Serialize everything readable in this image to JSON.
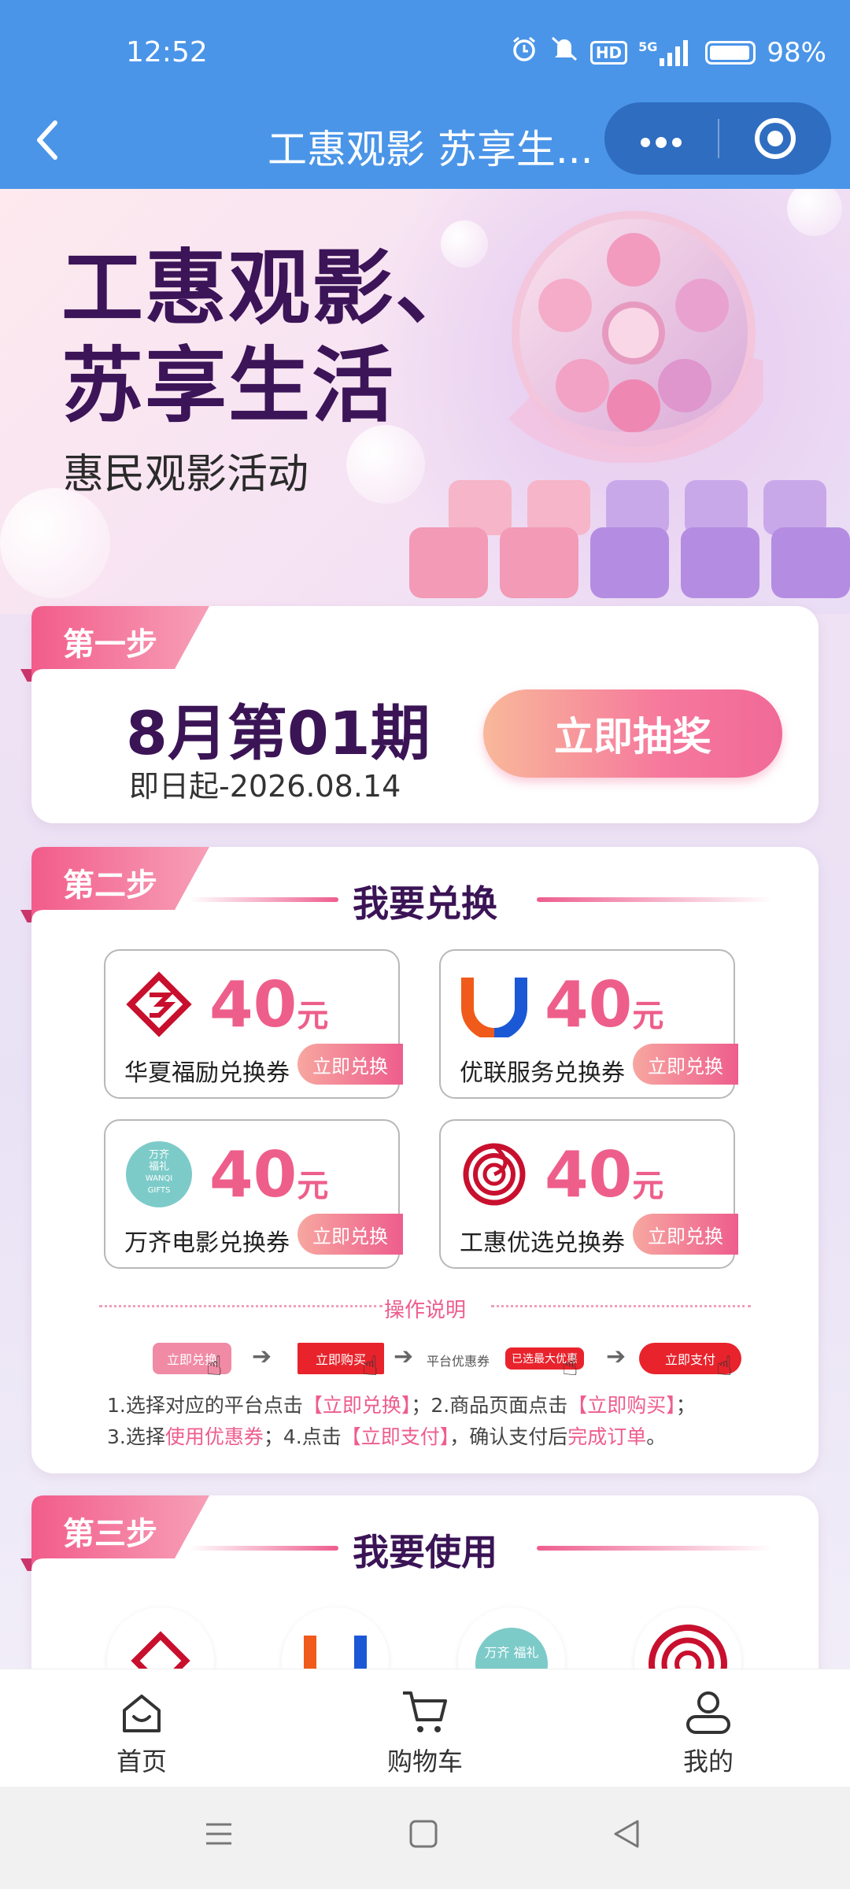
{
  "status_bar": {
    "time": "12:52",
    "network": "5G",
    "hd": "HD",
    "battery": "98%"
  },
  "nav": {
    "title": "工惠观影 苏享生...",
    "more_icon": "more-dots-icon",
    "capsule_icon": "target-icon"
  },
  "hero": {
    "title_line1": "工惠观影、",
    "title_line2": "苏享生活",
    "subtitle": "惠民观影活动"
  },
  "step1": {
    "tag": "第一步",
    "period": "8月第01期",
    "date": "即日起-2026.08.14",
    "button": "立即抽奖"
  },
  "step2": {
    "tag": "第二步",
    "title": "我要兑换",
    "coupons": [
      {
        "amount": "40",
        "unit": "元",
        "name": "华夏福励兑换券",
        "button": "立即兑换",
        "logo": "huaxia-logo"
      },
      {
        "amount": "40",
        "unit": "元",
        "name": "优联服务兑换券",
        "button": "立即兑换",
        "logo": "youlian-logo"
      },
      {
        "amount": "40",
        "unit": "元",
        "name": "万齐电影兑换券",
        "button": "立即兑换",
        "logo": "wanqi-logo",
        "logo_text": [
          "万齐",
          "福礼",
          "WANQI",
          "GIFTS"
        ]
      },
      {
        "amount": "40",
        "unit": "元",
        "name": "工惠优选兑换券",
        "button": "立即兑换",
        "logo": "gonghui-logo"
      }
    ],
    "howto_title": "操作说明",
    "flow": {
      "step1": "立即兑换",
      "step2": "立即购买",
      "step3_text": "平台优惠券",
      "step3_badge": "已选最大优惠",
      "step4": "立即支付"
    },
    "instructions": {
      "l1_a": "1.选择对应的平台点击",
      "l1_b": "【立即兑换】",
      "l1_c": "；2.商品页面点击",
      "l1_d": "【立即购买】",
      "l1_e": "；",
      "l2_a": "3.选择",
      "l2_b": "使用优惠券",
      "l2_c": "；4.点击",
      "l2_d": "【立即支付】",
      "l2_e": "，确认支付后",
      "l2_f": "完成订单",
      "l2_g": "。"
    }
  },
  "step3": {
    "tag": "第三步",
    "title": "我要使用",
    "wanqi_text": "万齐 福礼"
  },
  "tabbar": [
    {
      "label": "首页",
      "icon": "home-icon"
    },
    {
      "label": "购物车",
      "icon": "cart-icon"
    },
    {
      "label": "我的",
      "icon": "profile-icon"
    }
  ],
  "colors": {
    "topbar": "#4a95e8",
    "accent_pink": "#ee5d8d",
    "title_purple": "#3b1456"
  }
}
